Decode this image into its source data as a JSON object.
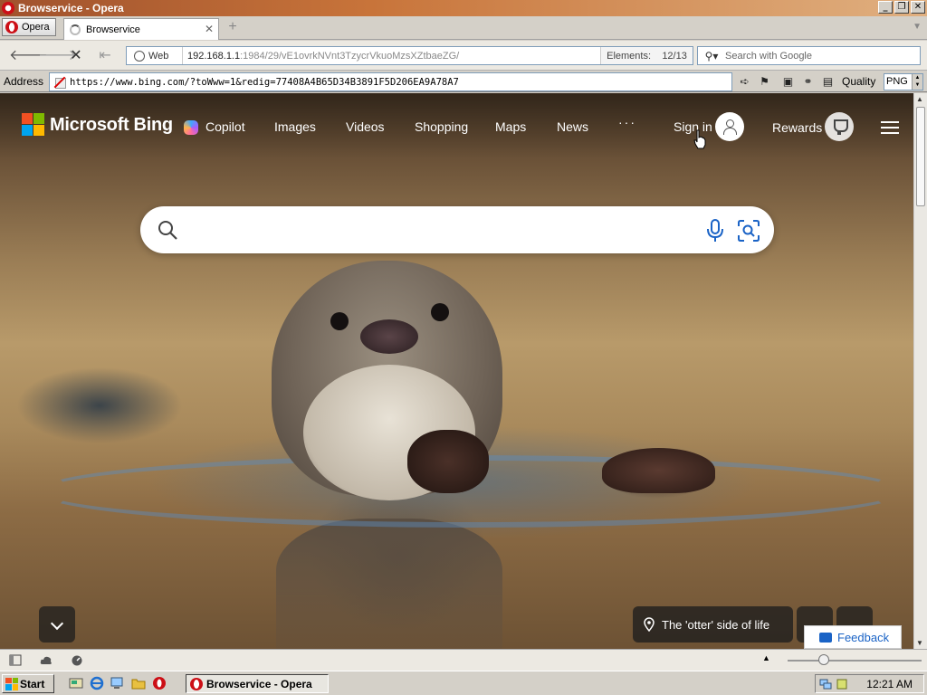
{
  "window": {
    "title": "Browservice - Opera",
    "controls": {
      "minimize": "_",
      "maximize": "❐",
      "close": "✕"
    }
  },
  "tabs": {
    "menu_label": "Opera",
    "active_tab": "Browservice",
    "new_tab": "+"
  },
  "navbar": {
    "security_label": "Web",
    "url_host": "192.168.1.1",
    "url_path": ":1984/29/vE1ovrkNVnt3TzycrVkuoMzsXZtbaeZG/",
    "elements_label": "Elements:",
    "elements_count": "12/13",
    "search_placeholder": "Search with Google"
  },
  "addressbar": {
    "label": "Address",
    "url": "https://www.bing.com/?toWww=1&redig=77408A4B65D34B3891F5D206EA9A78A7",
    "quality_label": "Quality",
    "quality_value": "PNG"
  },
  "bing": {
    "brand": "Microsoft Bing",
    "logo_colors": [
      "#f25022",
      "#7fba00",
      "#00a4ef",
      "#ffb900"
    ],
    "nav": {
      "copilot": "Copilot",
      "images": "Images",
      "videos": "Videos",
      "shopping": "Shopping",
      "maps": "Maps",
      "news": "News",
      "more": "···"
    },
    "sign_in": "Sign in",
    "rewards": "Rewards",
    "search_value": "",
    "caption": "The 'otter' side of life",
    "feedback": "Feedback",
    "accent": "#1a63c6"
  },
  "taskbar": {
    "start": "Start",
    "task_item": "Browservice - Opera",
    "clock": "12:21 AM"
  }
}
